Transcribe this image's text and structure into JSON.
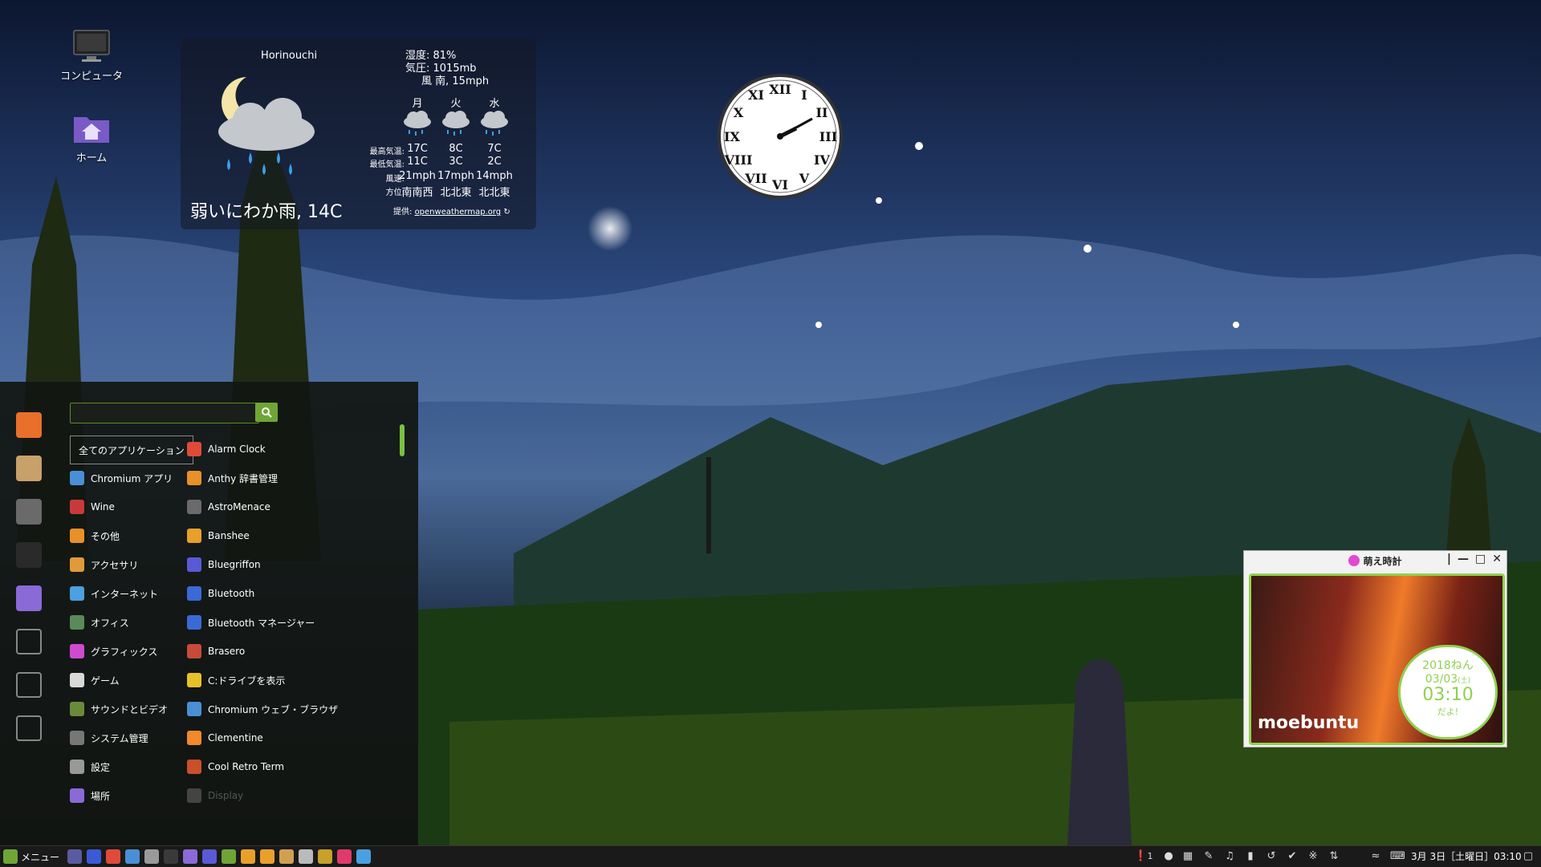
{
  "desktop": {
    "icons": [
      {
        "label": "コンピュータ"
      },
      {
        "label": "ホーム"
      }
    ]
  },
  "weather": {
    "location": "Horinouchi",
    "condition": "弱いにわか雨, 14C",
    "humidity": "湿度: 81%",
    "pressure": "気圧: 1015mb",
    "wind": "風 南, 15mph",
    "days": [
      "月",
      "火",
      "水"
    ],
    "row_labels": {
      "high": "最高気温:",
      "low": "最低気温:",
      "windspeed": "風速:",
      "direction": "方位:"
    },
    "highs": [
      "17C",
      "8C",
      "7C"
    ],
    "lows": [
      "11C",
      "3C",
      "2C"
    ],
    "windspeeds": [
      "21mph",
      "17mph",
      "14mph"
    ],
    "directions": [
      "南南西",
      "北北東",
      "北北東"
    ],
    "credit_label": "提供:",
    "credit_link": "openweathermap.org"
  },
  "menu": {
    "search": {
      "value": "",
      "placeholder": ""
    },
    "categories": [
      {
        "label": "全てのアプリケーション",
        "icon": "all-apps",
        "color": "#444444",
        "selected": true
      },
      {
        "label": "Chromium アプリ",
        "icon": "chromium",
        "color": "#4a8fd6"
      },
      {
        "label": "Wine",
        "icon": "wine",
        "color": "#c83a3a"
      },
      {
        "label": "その他",
        "icon": "other",
        "color": "#e8902a"
      },
      {
        "label": "アクセサリ",
        "icon": "accessories",
        "color": "#e09a3a"
      },
      {
        "label": "インターネット",
        "icon": "internet",
        "color": "#4aa0e0"
      },
      {
        "label": "オフィス",
        "icon": "office",
        "color": "#5a8a5a"
      },
      {
        "label": "グラフィックス",
        "icon": "graphics",
        "color": "#d04ad0"
      },
      {
        "label": "ゲーム",
        "icon": "games",
        "color": "#d8d8d8"
      },
      {
        "label": "サウンドとビデオ",
        "icon": "sound-video",
        "color": "#6a8a3a"
      },
      {
        "label": "システム管理",
        "icon": "system",
        "color": "#777777"
      },
      {
        "label": "設定",
        "icon": "settings",
        "color": "#999999"
      },
      {
        "label": "場所",
        "icon": "places",
        "color": "#8a6ad6"
      }
    ],
    "apps": [
      {
        "label": "Alarm Clock",
        "icon": "alarm-clock",
        "color": "#e04a3a"
      },
      {
        "label": "Anthy 辞書管理",
        "icon": "anthy",
        "color": "#e8902a"
      },
      {
        "label": "AstroMenace",
        "icon": "astromenace",
        "color": "#6a6a6a"
      },
      {
        "label": "Banshee",
        "icon": "banshee",
        "color": "#e8a02a"
      },
      {
        "label": "Bluegriffon",
        "icon": "bluegriffon",
        "color": "#5a5ad6"
      },
      {
        "label": "Bluetooth",
        "icon": "bluetooth",
        "color": "#3a6ad6"
      },
      {
        "label": "Bluetooth マネージャー",
        "icon": "bluetooth-manager",
        "color": "#3a6ad6"
      },
      {
        "label": "Brasero",
        "icon": "brasero",
        "color": "#c84a3a"
      },
      {
        "label": "C:ドライブを表示",
        "icon": "c-drive",
        "color": "#e8c02a"
      },
      {
        "label": "Chromium ウェブ・ブラウザ",
        "icon": "chromium-browser",
        "color": "#4a8fd6"
      },
      {
        "label": "Clementine",
        "icon": "clementine",
        "color": "#f08a2a"
      },
      {
        "label": "Cool Retro Term",
        "icon": "cool-retro-term",
        "color": "#c8502a"
      },
      {
        "label": "Display",
        "icon": "display",
        "color": "#444444",
        "dim": true
      }
    ],
    "favorites": [
      {
        "icon": "firefox",
        "color": "#e8702a"
      },
      {
        "icon": "package-manager",
        "color": "#c8a06a"
      },
      {
        "icon": "system-settings",
        "color": "#6a6a6a"
      },
      {
        "icon": "terminal",
        "color": "#2a2a2a"
      },
      {
        "icon": "folder",
        "color": "#8a6ad6"
      },
      {
        "icon": "lock-screen",
        "color": "#333333"
      },
      {
        "icon": "logout",
        "color": "#333333"
      },
      {
        "icon": "shutdown",
        "color": "#333333"
      }
    ]
  },
  "moe_clock": {
    "title": "萌え時計",
    "logo": "moebuntu",
    "year": "2018ねん",
    "date": "03/03",
    "weekday": "(土)",
    "time": "03:10",
    "suffix": "だよ!"
  },
  "taskbar": {
    "menu_label": "メニュー",
    "launchers": [
      {
        "icon": "show-desktop",
        "color": "#5a5aa0"
      },
      {
        "icon": "thunderbird",
        "color": "#3a5ad6"
      },
      {
        "icon": "chromium",
        "color": "#e04a3a"
      },
      {
        "icon": "web-browser",
        "color": "#4a8fd6"
      },
      {
        "icon": "image-viewer",
        "color": "#9a9a9a"
      },
      {
        "icon": "terminal",
        "color": "#3a3a3a"
      },
      {
        "icon": "files",
        "color": "#8a6ad6"
      },
      {
        "icon": "bluegriffon",
        "color": "#5a5ad6"
      },
      {
        "icon": "spotify",
        "color": "#6fa536"
      },
      {
        "icon": "text-editor",
        "color": "#e8a02a"
      },
      {
        "icon": "banshee",
        "color": "#e8a02a"
      },
      {
        "icon": "settings",
        "color": "#d0a050"
      },
      {
        "icon": "calculator",
        "color": "#bbbbbb"
      },
      {
        "icon": "system-monitor",
        "color": "#c8a02a"
      },
      {
        "icon": "media-player",
        "color": "#e03a6a"
      },
      {
        "icon": "network",
        "color": "#4aa0e0"
      }
    ],
    "tray": {
      "notification_count": "1",
      "datetime": "3月 3日［土曜日］03:10"
    }
  }
}
